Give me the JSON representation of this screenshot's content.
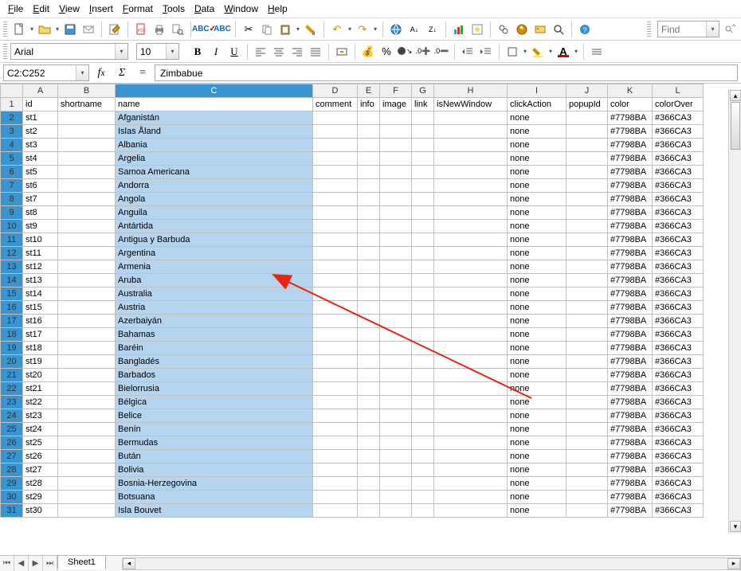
{
  "menu": [
    "File",
    "Edit",
    "View",
    "Insert",
    "Format",
    "Tools",
    "Data",
    "Window",
    "Help"
  ],
  "find_placeholder": "Find",
  "font": {
    "name": "Arial",
    "size": "10"
  },
  "cell_ref": "C2:C252",
  "formula_value": "Zimbabue",
  "columns": [
    "A",
    "B",
    "C",
    "D",
    "E",
    "F",
    "G",
    "H",
    "I",
    "J",
    "K",
    "L"
  ],
  "headers": {
    "A": "id",
    "B": "shortname",
    "C": "name",
    "D": "comment",
    "E": "info",
    "F": "image",
    "G": "link",
    "H": "isNewWindow",
    "I": "clickAction",
    "J": "popupId",
    "K": "color",
    "L": "colorOver"
  },
  "rows": [
    {
      "n": 2,
      "id": "st1",
      "name": "Afganistán",
      "click": "none",
      "color": "#7798BA",
      "over": "#366CA3"
    },
    {
      "n": 3,
      "id": "st2",
      "name": "Islas Åland",
      "click": "none",
      "color": "#7798BA",
      "over": "#366CA3"
    },
    {
      "n": 4,
      "id": "st3",
      "name": "Albania",
      "click": "none",
      "color": "#7798BA",
      "over": "#366CA3"
    },
    {
      "n": 5,
      "id": "st4",
      "name": "Argelia",
      "click": "none",
      "color": "#7798BA",
      "over": "#366CA3"
    },
    {
      "n": 6,
      "id": "st5",
      "name": "Samoa Americana",
      "click": "none",
      "color": "#7798BA",
      "over": "#366CA3"
    },
    {
      "n": 7,
      "id": "st6",
      "name": "Andorra",
      "click": "none",
      "color": "#7798BA",
      "over": "#366CA3"
    },
    {
      "n": 8,
      "id": "st7",
      "name": "Angola",
      "click": "none",
      "color": "#7798BA",
      "over": "#366CA3"
    },
    {
      "n": 9,
      "id": "st8",
      "name": "Anguila",
      "click": "none",
      "color": "#7798BA",
      "over": "#366CA3"
    },
    {
      "n": 10,
      "id": "st9",
      "name": "Antártida",
      "click": "none",
      "color": "#7798BA",
      "over": "#366CA3"
    },
    {
      "n": 11,
      "id": "st10",
      "name": "Antigua y Barbuda",
      "click": "none",
      "color": "#7798BA",
      "over": "#366CA3"
    },
    {
      "n": 12,
      "id": "st11",
      "name": "Argentina",
      "click": "none",
      "color": "#7798BA",
      "over": "#366CA3"
    },
    {
      "n": 13,
      "id": "st12",
      "name": "Armenia",
      "click": "none",
      "color": "#7798BA",
      "over": "#366CA3"
    },
    {
      "n": 14,
      "id": "st13",
      "name": "Aruba",
      "click": "none",
      "color": "#7798BA",
      "over": "#366CA3"
    },
    {
      "n": 15,
      "id": "st14",
      "name": "Australia",
      "click": "none",
      "color": "#7798BA",
      "over": "#366CA3"
    },
    {
      "n": 16,
      "id": "st15",
      "name": "Austria",
      "click": "none",
      "color": "#7798BA",
      "over": "#366CA3"
    },
    {
      "n": 17,
      "id": "st16",
      "name": "Azerbaiyán",
      "click": "none",
      "color": "#7798BA",
      "over": "#366CA3"
    },
    {
      "n": 18,
      "id": "st17",
      "name": "Bahamas",
      "click": "none",
      "color": "#7798BA",
      "over": "#366CA3"
    },
    {
      "n": 19,
      "id": "st18",
      "name": "Baréin",
      "click": "none",
      "color": "#7798BA",
      "over": "#366CA3"
    },
    {
      "n": 20,
      "id": "st19",
      "name": "Bangladés",
      "click": "none",
      "color": "#7798BA",
      "over": "#366CA3"
    },
    {
      "n": 21,
      "id": "st20",
      "name": "Barbados",
      "click": "none",
      "color": "#7798BA",
      "over": "#366CA3"
    },
    {
      "n": 22,
      "id": "st21",
      "name": "Bielorrusia",
      "click": "none",
      "color": "#7798BA",
      "over": "#366CA3"
    },
    {
      "n": 23,
      "id": "st22",
      "name": "Bélgica",
      "click": "none",
      "color": "#7798BA",
      "over": "#366CA3"
    },
    {
      "n": 24,
      "id": "st23",
      "name": "Belice",
      "click": "none",
      "color": "#7798BA",
      "over": "#366CA3"
    },
    {
      "n": 25,
      "id": "st24",
      "name": "Benín",
      "click": "none",
      "color": "#7798BA",
      "over": "#366CA3"
    },
    {
      "n": 26,
      "id": "st25",
      "name": "Bermudas",
      "click": "none",
      "color": "#7798BA",
      "over": "#366CA3"
    },
    {
      "n": 27,
      "id": "st26",
      "name": "Bután",
      "click": "none",
      "color": "#7798BA",
      "over": "#366CA3"
    },
    {
      "n": 28,
      "id": "st27",
      "name": "Bolivia",
      "click": "none",
      "color": "#7798BA",
      "over": "#366CA3"
    },
    {
      "n": 29,
      "id": "st28",
      "name": "Bosnia-Herzegovina",
      "click": "none",
      "color": "#7798BA",
      "over": "#366CA3"
    },
    {
      "n": 30,
      "id": "st29",
      "name": "Botsuana",
      "click": "none",
      "color": "#7798BA",
      "over": "#366CA3"
    },
    {
      "n": 31,
      "id": "st30",
      "name": "Isla Bouvet",
      "click": "none",
      "color": "#7798BA",
      "over": "#366CA3"
    }
  ],
  "sheet_tab": "Sheet1"
}
